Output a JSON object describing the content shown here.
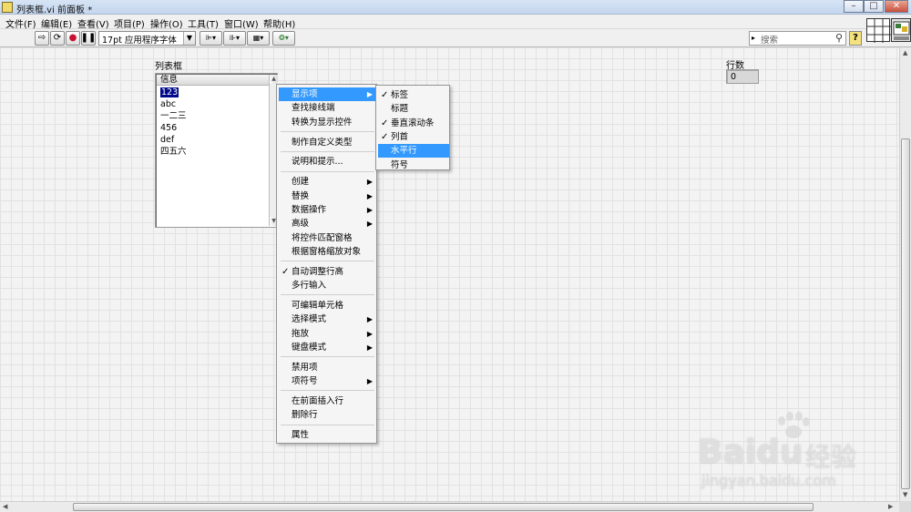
{
  "window": {
    "title": "列表框.vi 前面板 *",
    "min": "–",
    "max": "□",
    "close": "✕"
  },
  "menubar": [
    "文件(F)",
    "编辑(E)",
    "查看(V)",
    "项目(P)",
    "操作(O)",
    "工具(T)",
    "窗口(W)",
    "帮助(H)"
  ],
  "toolbar": {
    "font": "17pt 应用程序字体",
    "search_placeholder": "搜索",
    "help": "?"
  },
  "panel": {
    "listbox_label": "列表框",
    "listbox_header": "信息",
    "listbox_items": [
      "123",
      "abc",
      "一二三",
      "456",
      "def",
      "四五六"
    ],
    "selected_index": 0,
    "rows_label": "行数",
    "rows_value": "0"
  },
  "context_menu": [
    {
      "label": "显示项",
      "submenu": true,
      "highlighted": true
    },
    {
      "label": "查找接线端"
    },
    {
      "label": "转换为显示控件"
    },
    {
      "separator": true
    },
    {
      "label": "制作自定义类型"
    },
    {
      "separator": true
    },
    {
      "label": "说明和提示..."
    },
    {
      "separator": true
    },
    {
      "label": "创建",
      "submenu": true
    },
    {
      "label": "替换",
      "submenu": true
    },
    {
      "label": "数据操作",
      "submenu": true
    },
    {
      "label": "高级",
      "submenu": true
    },
    {
      "label": "将控件匹配窗格"
    },
    {
      "label": "根据窗格缩放对象"
    },
    {
      "separator": true
    },
    {
      "label": "自动调整行高",
      "checked": true
    },
    {
      "label": "多行输入"
    },
    {
      "separator": true
    },
    {
      "label": "可编辑单元格"
    },
    {
      "label": "选择模式",
      "submenu": true
    },
    {
      "label": "拖放",
      "submenu": true
    },
    {
      "label": "键盘模式",
      "submenu": true
    },
    {
      "separator": true
    },
    {
      "label": "禁用项"
    },
    {
      "label": "项符号",
      "submenu": true
    },
    {
      "separator": true
    },
    {
      "label": "在前面插入行"
    },
    {
      "label": "删除行"
    },
    {
      "separator": true
    },
    {
      "label": "属性"
    }
  ],
  "submenu": [
    {
      "label": "标签",
      "checked": true
    },
    {
      "label": "标题"
    },
    {
      "label": "垂直滚动条",
      "checked": true
    },
    {
      "label": "列首",
      "checked": true
    },
    {
      "label": "水平行",
      "highlighted": true
    },
    {
      "label": "符号"
    }
  ],
  "watermark": {
    "brand": "Baidu",
    "cn": "经验",
    "url": "jingyan.baidu.com"
  },
  "colors": {
    "selection": "#000a8a",
    "menu_highlight": "#3399ff"
  }
}
